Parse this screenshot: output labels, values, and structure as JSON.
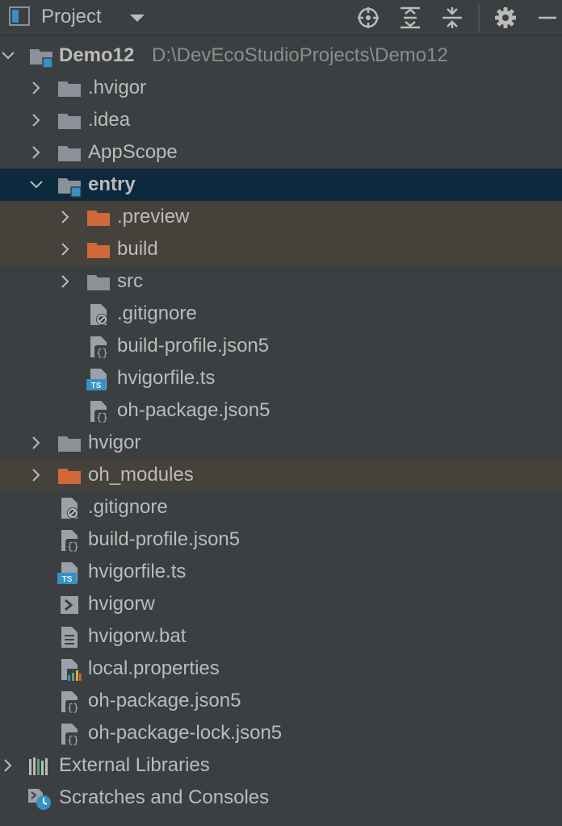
{
  "header": {
    "title": "Project",
    "icons": [
      "project-view-icon",
      "dropdown-icon",
      "locate-icon",
      "expand-all-icon",
      "collapse-all-icon",
      "settings-icon",
      "hide-icon"
    ]
  },
  "colors": {
    "background": "#3c3f41",
    "selected_row": "#0d293e",
    "excluded_row": "#45423b",
    "folder": "#8a9199",
    "excluded_folder": "#d0683a",
    "module_accent": "#3592c4",
    "text": "#bbbbbb",
    "path_text": "#8c8c8c"
  },
  "tree": {
    "root": {
      "label": "Demo12",
      "path": "D:\\DevEcoStudioProjects\\Demo12"
    },
    "items": [
      {
        "label": ".hvigor"
      },
      {
        "label": ".idea"
      },
      {
        "label": "AppScope"
      },
      {
        "label": "entry"
      },
      {
        "label": ".preview"
      },
      {
        "label": "build"
      },
      {
        "label": "src"
      },
      {
        "label": ".gitignore"
      },
      {
        "label": "build-profile.json5"
      },
      {
        "label": "hvigorfile.ts"
      },
      {
        "label": "oh-package.json5"
      },
      {
        "label": "hvigor"
      },
      {
        "label": "oh_modules"
      },
      {
        "label": ".gitignore"
      },
      {
        "label": "build-profile.json5"
      },
      {
        "label": "hvigorfile.ts"
      },
      {
        "label": "hvigorw"
      },
      {
        "label": "hvigorw.bat"
      },
      {
        "label": "local.properties"
      },
      {
        "label": "oh-package.json5"
      },
      {
        "label": "oh-package-lock.json5"
      },
      {
        "label": "External Libraries"
      },
      {
        "label": "Scratches and Consoles"
      }
    ]
  }
}
